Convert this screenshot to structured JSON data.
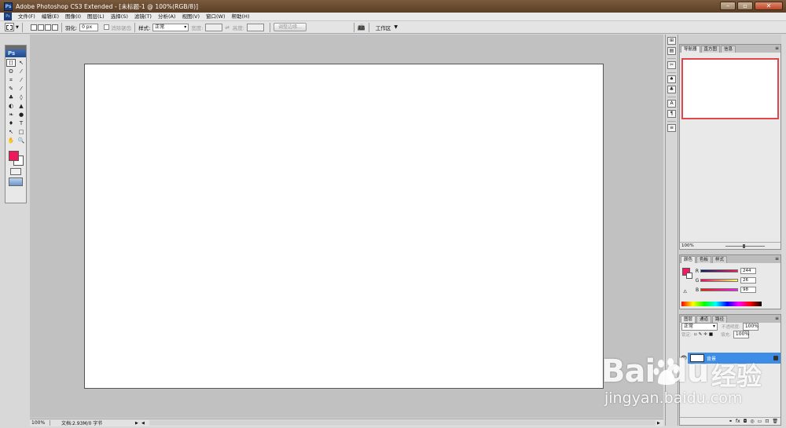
{
  "app": {
    "window_title": "Adobe Photoshop CS3 Extended - [未标题-1 @ 100%(RGB/8)]",
    "logo": "Ps",
    "menu_logo": "Ps"
  },
  "menu": [
    "文件(F)",
    "编辑(E)",
    "图像(I)",
    "图层(L)",
    "选择(S)",
    "滤镜(T)",
    "分析(A)",
    "视图(V)",
    "窗口(W)",
    "帮助(H)"
  ],
  "options": {
    "feather_label": "羽化:",
    "feather_value": "0 px",
    "antialias_label": "消除锯齿",
    "style_label": "样式:",
    "style_value": "正常",
    "width_label": "宽度:",
    "height_label": "高度:",
    "refine_label": "调整边缘...",
    "workspace_label": "工作区"
  },
  "toolbox": {
    "foreground_color": "#f0185a",
    "background_color": "#ffffff",
    "tools": [
      "[]",
      "↖",
      "ʘ",
      "⁄",
      "⌗",
      "⁄",
      "✎",
      "⁄",
      "♣",
      "◊",
      "◐",
      "▲",
      "❧",
      "●",
      "♦",
      "T",
      "↖",
      "□",
      "✋",
      "🔍"
    ]
  },
  "status": {
    "zoom": "100%",
    "doc_info": "文档:2.93M/0 字节"
  },
  "navigator": {
    "tabs": [
      "导航器",
      "直方图",
      "信息"
    ],
    "zoom": "100%",
    "view_box_color": "#e0474c"
  },
  "color_panel": {
    "tabs": [
      "颜色",
      "色板",
      "样式"
    ],
    "channels": [
      {
        "name": "R",
        "value": "244"
      },
      {
        "name": "G",
        "value": "26"
      },
      {
        "name": "B",
        "value": "98"
      }
    ],
    "fg_color": "#f41a62"
  },
  "layers_panel": {
    "tabs": [
      "图层",
      "通道",
      "路径"
    ],
    "blend_mode": "正常",
    "opacity_label": "不透明度:",
    "opacity_value": "100%",
    "lock_label": "锁定:",
    "fill_label": "填充:",
    "fill_value": "100%",
    "layers": [
      {
        "name": "背景",
        "selected": true
      }
    ],
    "footer_icons": [
      "fx",
      "◘",
      "◎",
      "▭",
      "⊡",
      "🗑"
    ]
  },
  "watermark": {
    "brand": "Bai  du",
    "brand_cn": "经验",
    "url": "jingyan.baidu.com"
  }
}
